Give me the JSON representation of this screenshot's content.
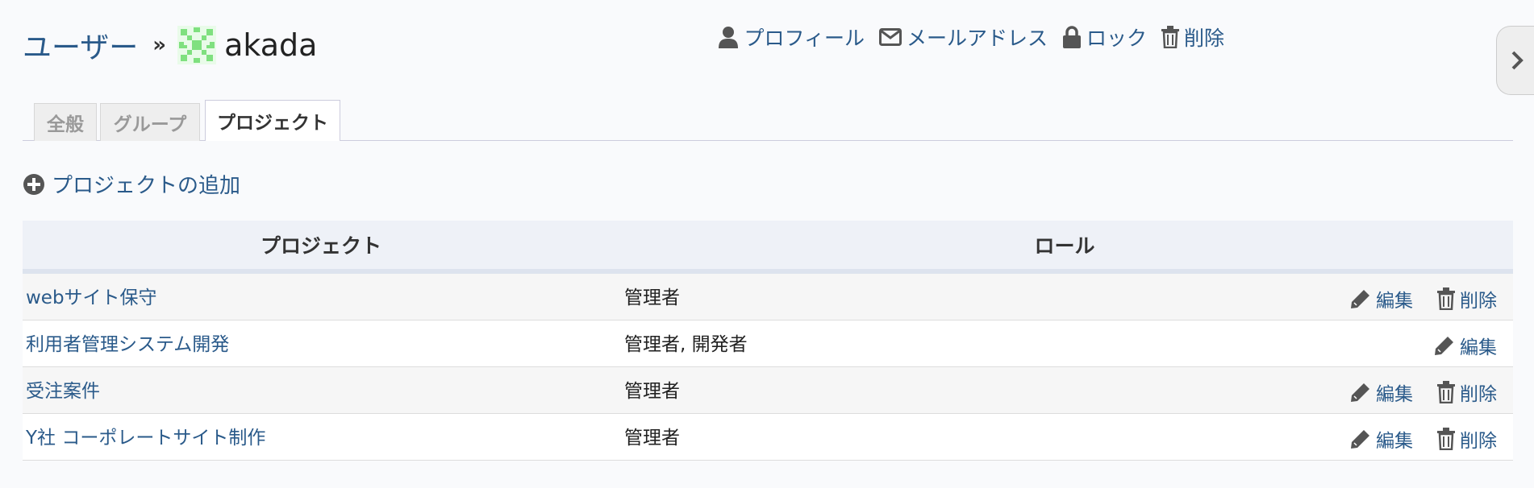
{
  "header": {
    "breadcrumb_root": "ユーザー",
    "separator": "»",
    "username": "akada"
  },
  "actions": {
    "profile": "プロフィール",
    "email": "メールアドレス",
    "lock": "ロック",
    "delete": "削除"
  },
  "tabs": [
    {
      "label": "全般",
      "active": false
    },
    {
      "label": "グループ",
      "active": false
    },
    {
      "label": "プロジェクト",
      "active": true
    }
  ],
  "add_project_label": "プロジェクトの追加",
  "table": {
    "headers": [
      "プロジェクト",
      "ロール"
    ],
    "rows": [
      {
        "project": "webサイト保守",
        "role": "管理者",
        "edit": "編集",
        "delete": "削除"
      },
      {
        "project": "利用者管理システム開発",
        "role": "管理者, 開発者",
        "edit": "編集"
      },
      {
        "project": "受注案件",
        "role": "管理者",
        "edit": "編集",
        "delete": "削除"
      },
      {
        "project": "Y社 コーポレートサイト制作",
        "role": "管理者",
        "edit": "編集",
        "delete": "削除"
      }
    ]
  },
  "colors": {
    "link": "#2a5a8a",
    "avatar": "#7fe07f",
    "header_bg": "#eef1f7"
  }
}
